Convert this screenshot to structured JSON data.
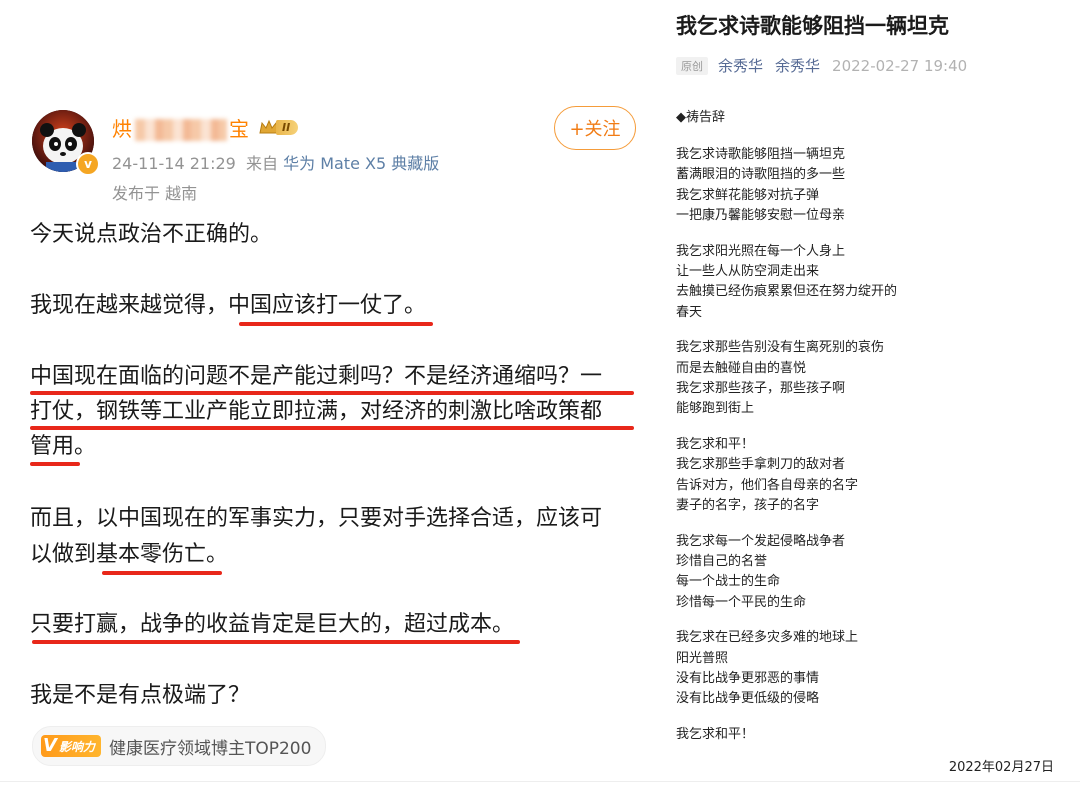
{
  "post": {
    "username_prefix": "烘",
    "username_suffix": "宝",
    "level_label": "II",
    "follow_label": "+关注",
    "timestamp": "24-11-14 21:29",
    "from_label": "来自",
    "device": "华为 Mate X5 典藏版",
    "location": "发布于 越南",
    "paragraphs": {
      "p1": "今天说点政治不正确的。",
      "p2": "我现在越来越觉得，中国应该打一仗了。",
      "p3_l1": "中国现在面临的问题不是产能过剩吗？不是经济通缩吗？一",
      "p3_l2": "打仗，钢铁等工业产能立即拉满，对经济的刺激比啥政策都",
      "p3_l3": "管用。",
      "p4_l1": "而且，以中国现在的军事实力，只要对手选择合适，应该可",
      "p4_l2": "以做到基本零伤亡。",
      "p5": "只要打赢，战争的收益肯定是巨大的，超过成本。",
      "p6": "我是不是有点极端了？"
    },
    "influence": {
      "logo_letter": "V",
      "logo_text": "影响力",
      "text": "健康医疗领域博主TOP200"
    }
  },
  "article": {
    "title": "我乞求诗歌能够阻挡一辆坦克",
    "original_tag": "原创",
    "author1": "余秀华",
    "author2": "余秀华",
    "date": "2022-02-27 19:40",
    "heading": "◆祷告辞",
    "stanzas": {
      "s1": [
        "我乞求诗歌能够阻挡一辆坦克",
        "蓄满眼泪的诗歌阻挡的多一些",
        "我乞求鲜花能够对抗子弹",
        "一把康乃馨能够安慰一位母亲"
      ],
      "s2": [
        "我乞求阳光照在每一个人身上",
        "让一些人从防空洞走出来",
        "去触摸已经伤痕累累但还在努力绽开的",
        "春天"
      ],
      "s3": [
        "我乞求那些告别没有生离死别的哀伤",
        "而是去触碰自由的喜悦",
        "我乞求那些孩子，那些孩子啊",
        "能够跑到街上"
      ],
      "s4": [
        "我乞求和平！",
        "我乞求那些手拿刺刀的敌对者",
        "告诉对方，他们各自母亲的名字",
        "妻子的名字，孩子的名字"
      ],
      "s5": [
        "我乞求每一个发起侵略战争者",
        "珍惜自己的名誉",
        "每一个战士的生命",
        "珍惜每一个平民的生命"
      ],
      "s6": [
        "我乞求在已经多灾多难的地球上",
        "阳光普照",
        "没有比战争更邪恶的事情",
        "没有比战争更低级的侵略"
      ]
    },
    "closing": "我乞求和平！",
    "signature_date": "2022年02月27日"
  },
  "colors": {
    "username": "#ff8200",
    "follow_border": "#f59c3a",
    "underline": "#e8271a",
    "author_link": "#576b95",
    "meta_gray": "#939393"
  }
}
